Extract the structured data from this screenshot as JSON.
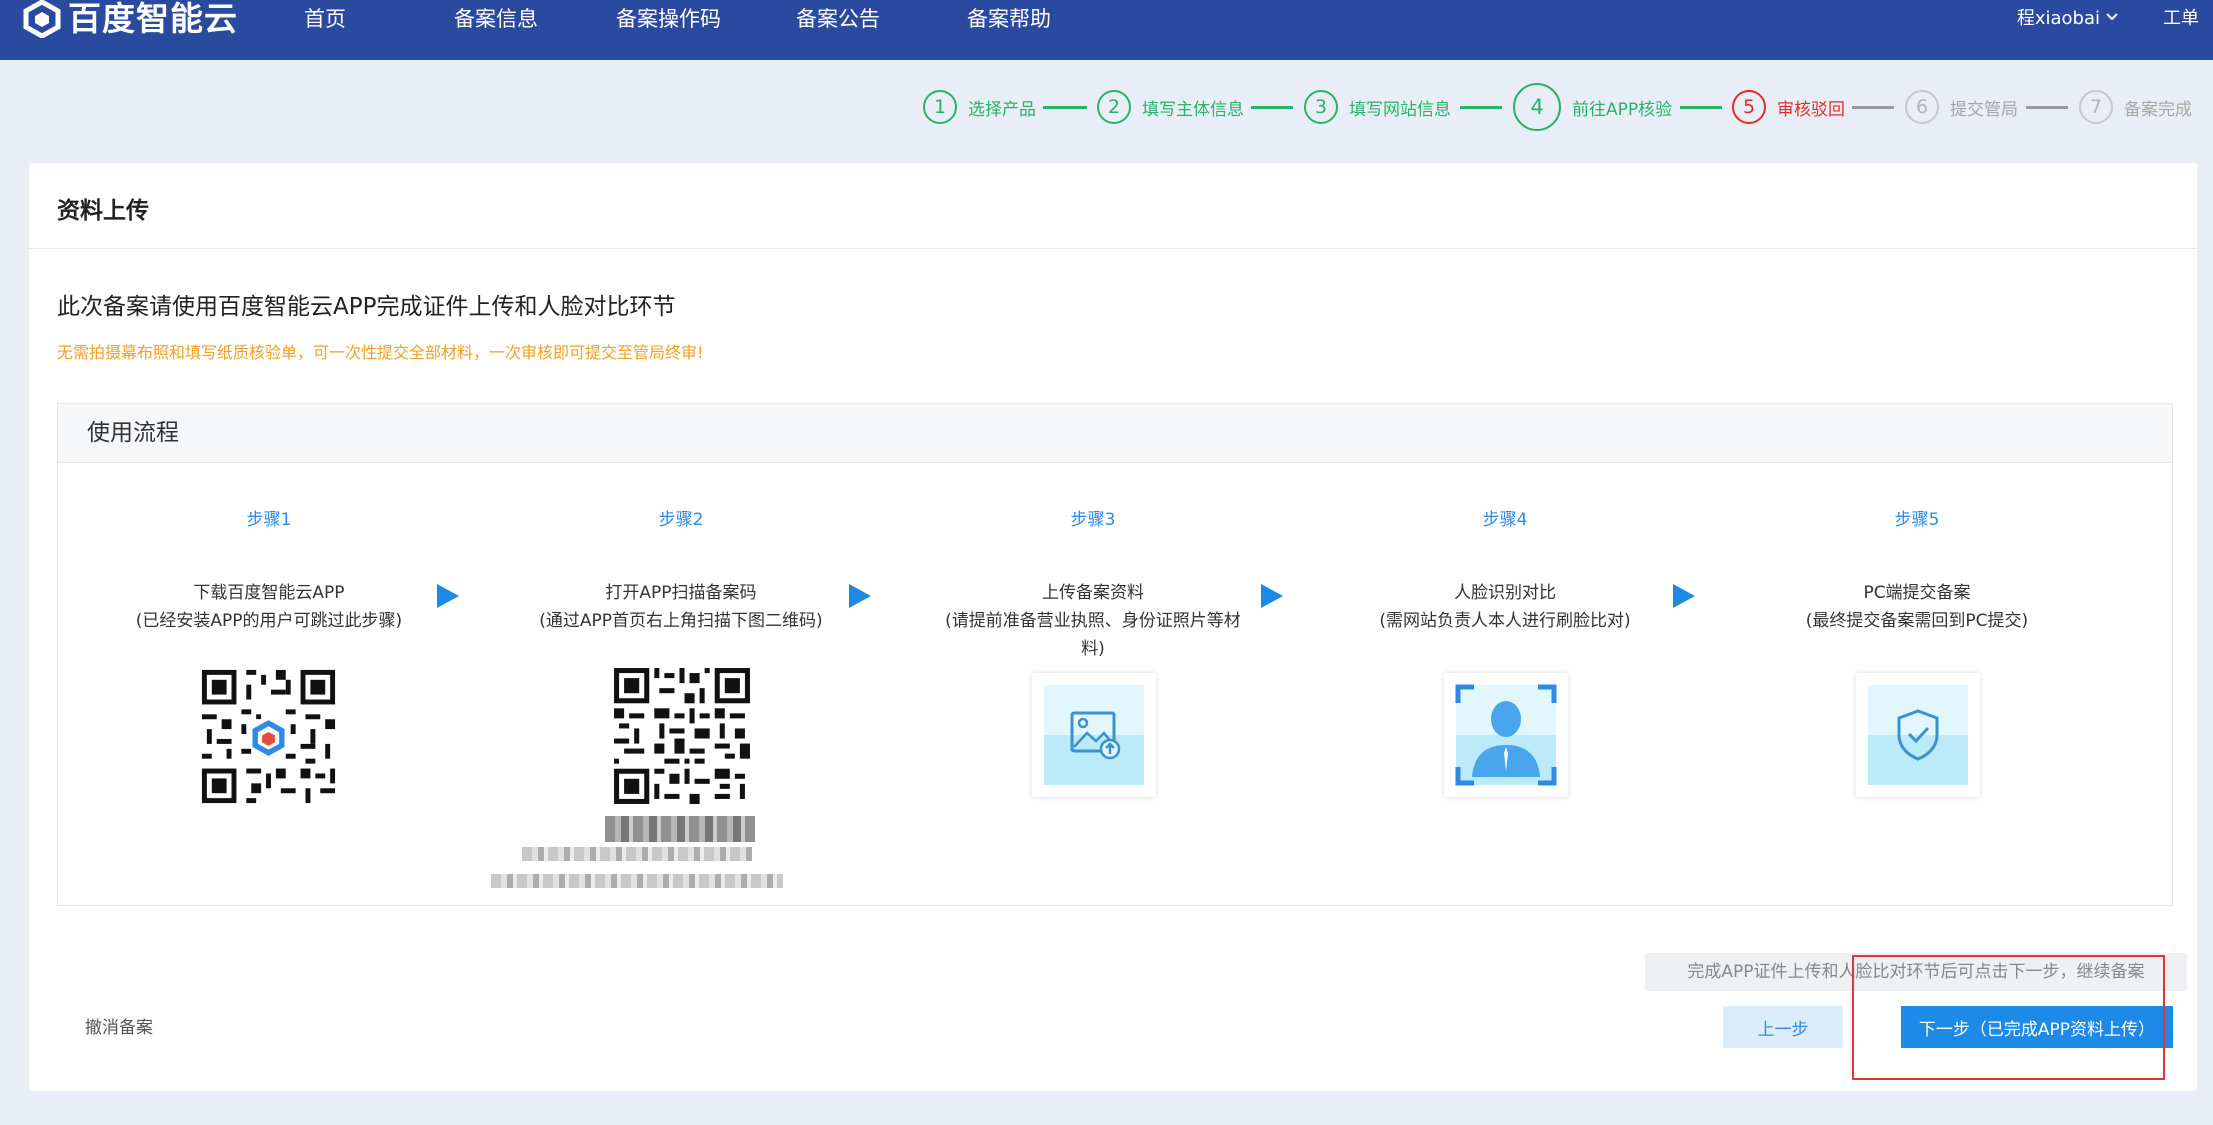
{
  "brand": {
    "name": "百度智能云"
  },
  "nav": {
    "items": [
      "首页",
      "备案信息",
      "备案操作码",
      "备案公告",
      "备案帮助"
    ],
    "user": "程xiaobai",
    "workorder": "工单"
  },
  "stepper": {
    "steps": [
      {
        "num": "1",
        "label": "选择产品",
        "state": "done"
      },
      {
        "num": "2",
        "label": "填写主体信息",
        "state": "done"
      },
      {
        "num": "3",
        "label": "填写网站信息",
        "state": "done"
      },
      {
        "num": "4",
        "label": "前往APP核验",
        "state": "done"
      },
      {
        "num": "5",
        "label": "审核驳回",
        "state": "error"
      },
      {
        "num": "6",
        "label": "提交管局",
        "state": "todo"
      },
      {
        "num": "7",
        "label": "备案完成",
        "state": "todo"
      }
    ]
  },
  "card": {
    "title": "资料上传",
    "intro_title": "此次备案请使用百度智能云APP完成证件上传和人脸对比环节",
    "intro_note": "无需拍摄幕布照和填写纸质核验单，可一次性提交全部材料，一次审核即可提交至管局终审!"
  },
  "flow": {
    "title": "使用流程",
    "steps": [
      {
        "title": "步骤1",
        "line1": "下载百度智能云APP",
        "line2": "(已经安装APP的用户可跳过此步骤)"
      },
      {
        "title": "步骤2",
        "line1": "打开APP扫描备案码",
        "line2": "(通过APP首页右上角扫描下图二维码)"
      },
      {
        "title": "步骤3",
        "line1": "上传备案资料",
        "line2": "(请提前准备营业执照、身份证照片等材",
        "line3": "料)"
      },
      {
        "title": "步骤4",
        "line1": "人脸识别对比",
        "line2": "(需网站负责人本人进行刷脸比对)"
      },
      {
        "title": "步骤5",
        "line1": "PC端提交备案",
        "line2": "(最终提交备案需回到PC提交)"
      }
    ]
  },
  "footer": {
    "cancel": "撤消备案",
    "hint": "完成APP证件上传和人脸比对环节后可点击下一步，继续备案",
    "prev": "上一步",
    "next": "下一步（已完成APP资料上传）"
  },
  "colors": {
    "nav_bg": "#2a4aa0",
    "done": "#27b36a",
    "error": "#e42b2b",
    "accent": "#1e8ae8",
    "note": "#f3a024"
  }
}
